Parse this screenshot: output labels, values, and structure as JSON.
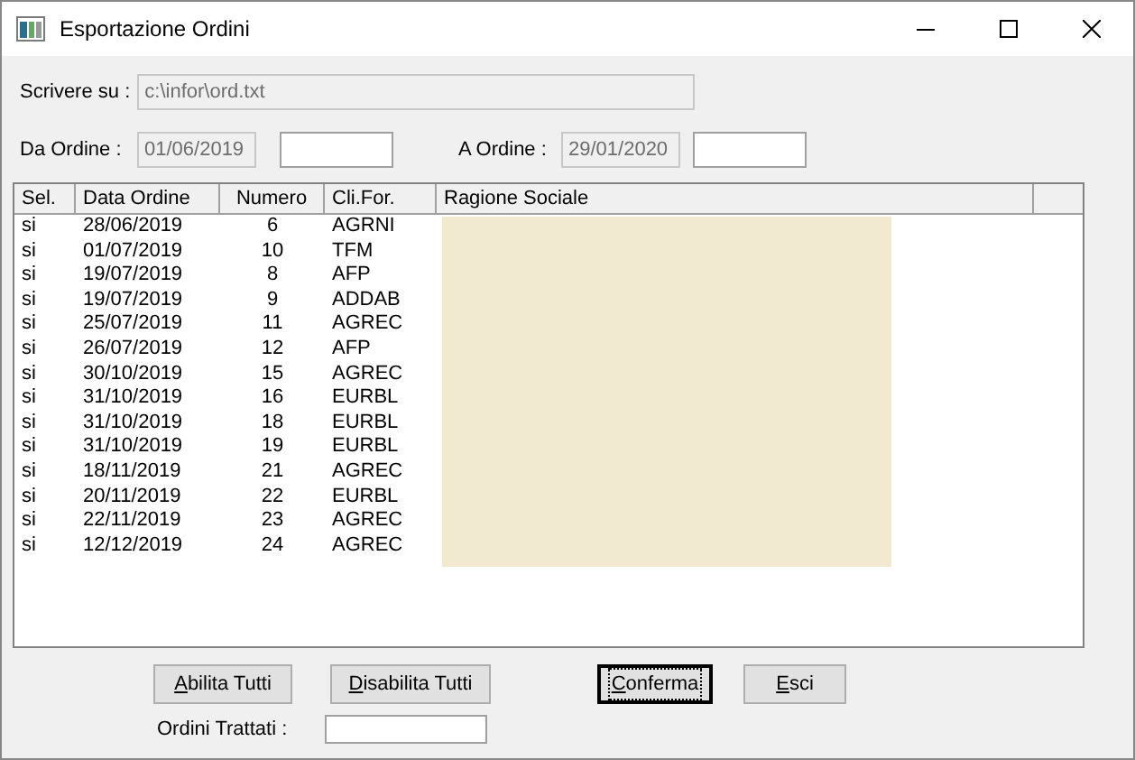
{
  "window": {
    "title": "Esportazione Ordini"
  },
  "file_field": {
    "label": "Scrivere su :",
    "value": "c:\\infor\\ord.txt"
  },
  "from_order": {
    "label": "Da Ordine :",
    "value": "01/06/2019"
  },
  "to_order": {
    "label": "A Ordine :",
    "value": "29/01/2020"
  },
  "table": {
    "columns": [
      "Sel.",
      "Data Ordine",
      "Numero",
      "Cli.For.",
      "Ragione Sociale"
    ],
    "rows": [
      {
        "sel": "si",
        "date": "28/06/2019",
        "number": "6",
        "code": "AGRNI"
      },
      {
        "sel": "si",
        "date": "01/07/2019",
        "number": "10",
        "code": "TFM"
      },
      {
        "sel": "si",
        "date": "19/07/2019",
        "number": "8",
        "code": "AFP"
      },
      {
        "sel": "si",
        "date": "19/07/2019",
        "number": "9",
        "code": "ADDAB"
      },
      {
        "sel": "si",
        "date": "25/07/2019",
        "number": "11",
        "code": "AGREC"
      },
      {
        "sel": "si",
        "date": "26/07/2019",
        "number": "12",
        "code": "AFP"
      },
      {
        "sel": "si",
        "date": "30/10/2019",
        "number": "15",
        "code": "AGREC"
      },
      {
        "sel": "si",
        "date": "31/10/2019",
        "number": "16",
        "code": "EURBL"
      },
      {
        "sel": "si",
        "date": "31/10/2019",
        "number": "18",
        "code": "EURBL"
      },
      {
        "sel": "si",
        "date": "31/10/2019",
        "number": "19",
        "code": "EURBL"
      },
      {
        "sel": "si",
        "date": "18/11/2019",
        "number": "21",
        "code": "AGREC"
      },
      {
        "sel": "si",
        "date": "20/11/2019",
        "number": "22",
        "code": "EURBL"
      },
      {
        "sel": "si",
        "date": "22/11/2019",
        "number": "23",
        "code": "AGREC"
      },
      {
        "sel": "si",
        "date": "12/12/2019",
        "number": "24",
        "code": "AGREC"
      }
    ]
  },
  "buttons": [
    {
      "label": "Abilita Tutti",
      "default": false
    },
    {
      "label": "Disabilita Tutti",
      "default": false
    },
    {
      "label": "Conferma",
      "default": true
    },
    {
      "label": "Esci",
      "default": false
    }
  ],
  "processed": {
    "label": "Ordini Trattati :"
  }
}
